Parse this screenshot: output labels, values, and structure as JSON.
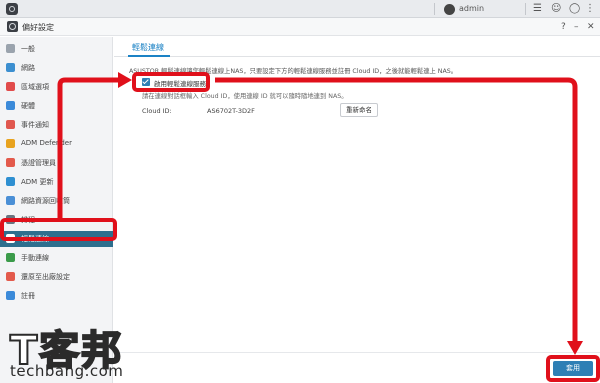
{
  "topbar": {
    "user_name": "admin",
    "icons": [
      "home-icon",
      "user-icon",
      "chat-icon",
      "smile-icon",
      "more-icon"
    ]
  },
  "window": {
    "title": "偏好設定",
    "buttons": [
      "help-icon",
      "minimize-icon",
      "close-icon"
    ]
  },
  "sidebar": {
    "items": [
      {
        "label": "一般",
        "icon": "home-icon",
        "color": "#9aa3ad"
      },
      {
        "label": "網路",
        "icon": "globe-icon",
        "color": "#3c8fd0"
      },
      {
        "label": "區域選項",
        "icon": "region-icon",
        "color": "#e14b4b"
      },
      {
        "label": "硬體",
        "icon": "chip-icon",
        "color": "#3b8ad9"
      },
      {
        "label": "事件通知",
        "icon": "bell-icon",
        "color": "#e0574f"
      },
      {
        "label": "ADM Defender",
        "icon": "shield-icon",
        "color": "#e8a31f"
      },
      {
        "label": "憑證管理員",
        "icon": "certificate-icon",
        "color": "#e35a4c"
      },
      {
        "label": "ADM 更新",
        "icon": "update-icon",
        "color": "#2e8fd1"
      },
      {
        "label": "網路資源回收筒",
        "icon": "recycle-icon",
        "color": "#4a8fd6"
      },
      {
        "label": "排程",
        "icon": "calendar-icon",
        "color": "#6a7480"
      },
      {
        "label": "輕鬆連線",
        "icon": "cloud-icon",
        "color": "#ffffff"
      },
      {
        "label": "手動連線",
        "icon": "link-icon",
        "color": "#3b9b4a"
      },
      {
        "label": "還原至出廠設定",
        "icon": "restore-icon",
        "color": "#e35a4c"
      },
      {
        "label": "註冊",
        "icon": "register-icon",
        "color": "#3b8ad9"
      }
    ],
    "active_index": 10
  },
  "content": {
    "tab_label": "輕鬆連線",
    "description": "ASUSTOR 輕鬆連線讓您輕鬆連線上NAS，只要設定下方的輕鬆連線服務並註冊 Cloud ID，之後就能輕鬆連上 NAS。",
    "checkbox_label": "啟用輕鬆連線服務",
    "checkbox_checked": true,
    "hint": "請在連線對話框輸入 Cloud ID，使用連線 ID 就可以隨時隨地連到 NAS。",
    "cloud_id_label": "Cloud ID:",
    "cloud_id_value": "AS6702T-3D2F",
    "rename_button": "重新命名",
    "apply_button": "套用"
  },
  "colors": {
    "accent": "#1b82c5",
    "active_nav": "#2e6f8e",
    "annotation": "#e0101b"
  },
  "watermark": {
    "main": "T客邦",
    "sub": "techbang.com"
  }
}
